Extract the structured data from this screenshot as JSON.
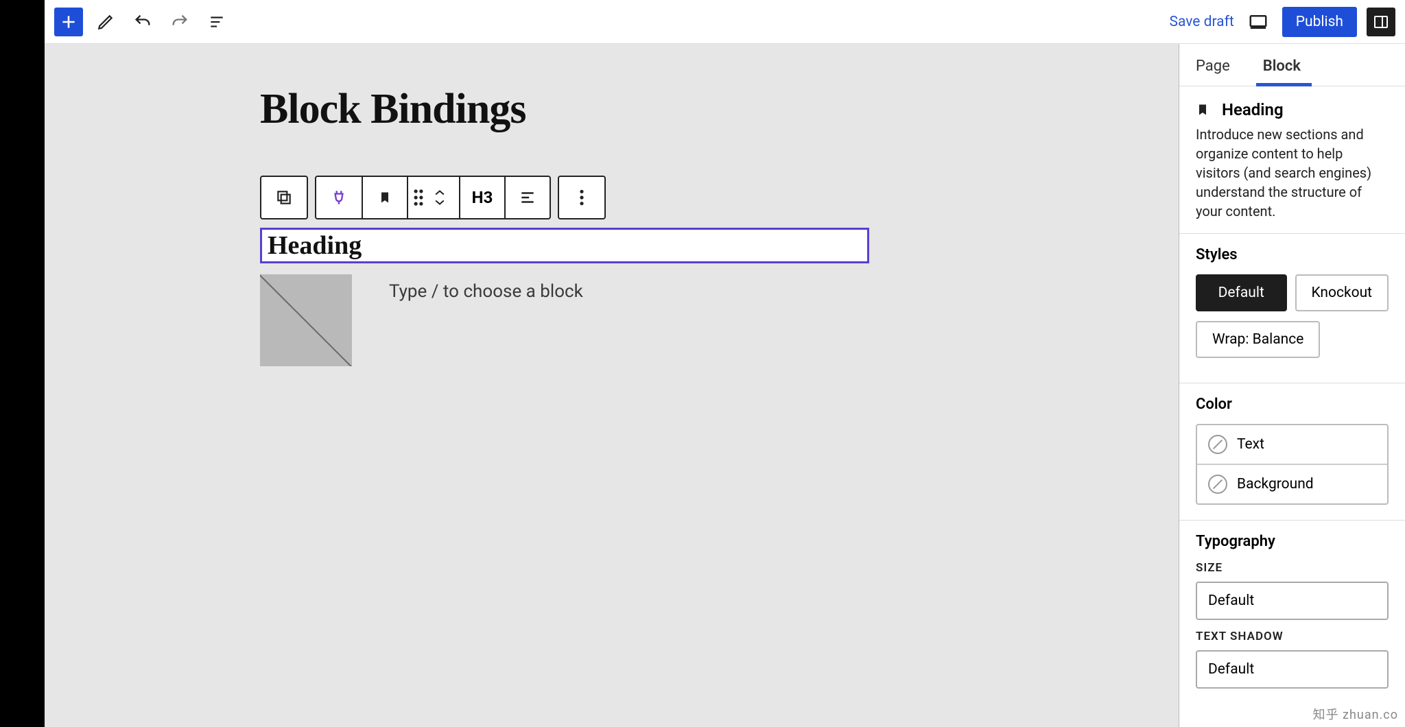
{
  "topbar": {
    "save_draft": "Save draft",
    "publish": "Publish"
  },
  "canvas": {
    "title": "Block Bindings",
    "heading_text": "Heading",
    "heading_level": "H3",
    "paragraph_placeholder": "Type / to choose a block"
  },
  "sidebar": {
    "tabs": {
      "page": "Page",
      "block": "Block"
    },
    "block_header": {
      "title": "Heading",
      "description": "Introduce new sections and organize content to help visitors (and search engines) understand the structure of your content."
    },
    "styles": {
      "title": "Styles",
      "default": "Default",
      "knockout": "Knockout",
      "wrap_balance": "Wrap: Balance"
    },
    "color": {
      "title": "Color",
      "text": "Text",
      "background": "Background"
    },
    "typography": {
      "title": "Typography",
      "size_label": "SIZE",
      "size_value": "Default",
      "shadow_label": "TEXT SHADOW",
      "shadow_value": "Default"
    }
  },
  "watermark": "知乎 zhuan.co"
}
